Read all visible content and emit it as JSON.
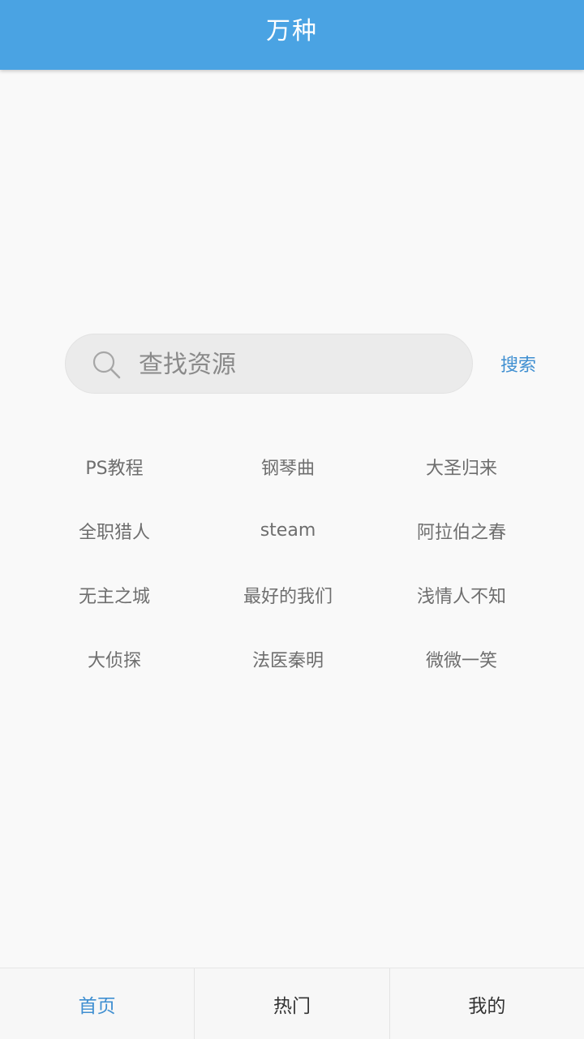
{
  "header": {
    "title": "万种"
  },
  "search": {
    "placeholder": "查找资源",
    "value": "",
    "button_label": "搜索",
    "icon": "search-icon"
  },
  "tags": [
    "PS教程",
    "钢琴曲",
    "大圣归来",
    "全职猎人",
    "steam",
    "阿拉伯之春",
    "无主之城",
    "最好的我们",
    "浅情人不知",
    "大侦探",
    "法医秦明",
    "微微一笑"
  ],
  "bottom_nav": {
    "items": [
      {
        "label": "首页",
        "active": true
      },
      {
        "label": "热门",
        "active": false
      },
      {
        "label": "我的",
        "active": false
      }
    ]
  },
  "colors": {
    "header_bg": "#4aa3e3",
    "accent": "#3f8fd1",
    "background": "#f9f9f9"
  }
}
